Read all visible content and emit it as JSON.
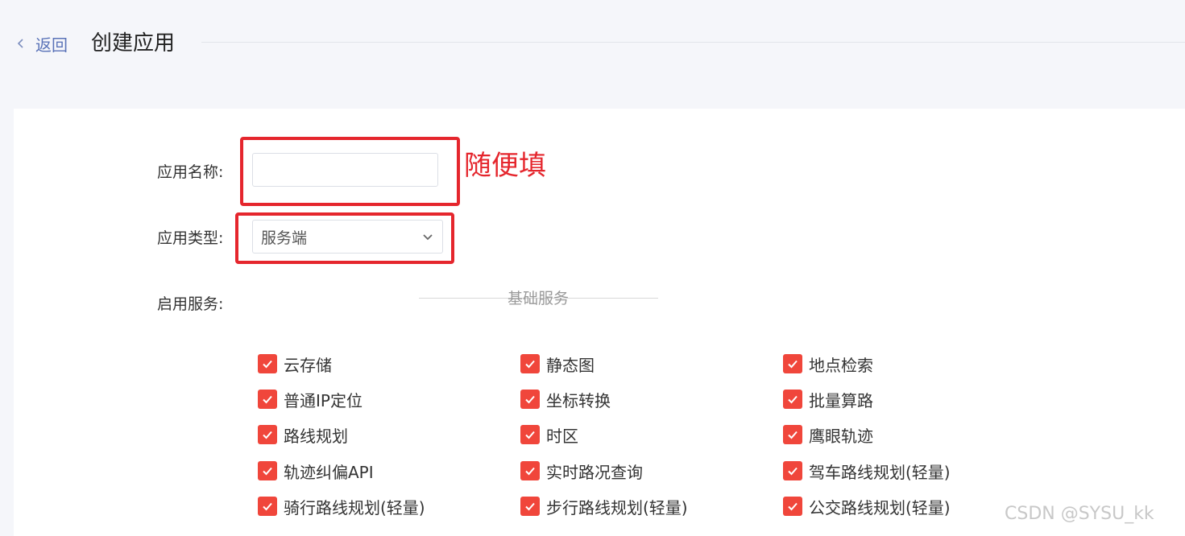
{
  "header": {
    "back_label": "返回",
    "title": "创建应用"
  },
  "form": {
    "name_label": "应用名称:",
    "name_value": "",
    "type_label": "应用类型:",
    "type_value": "服务端",
    "services_label": "启用服务:"
  },
  "annotation": {
    "text": "随便填",
    "color": "#e5262d"
  },
  "services": {
    "section_title": "基础服务",
    "items": [
      {
        "label": "云存储",
        "checked": true
      },
      {
        "label": "静态图",
        "checked": true
      },
      {
        "label": "地点检索",
        "checked": true
      },
      {
        "label": "普通IP定位",
        "checked": true
      },
      {
        "label": "坐标转换",
        "checked": true
      },
      {
        "label": "批量算路",
        "checked": true
      },
      {
        "label": "路线规划",
        "checked": true
      },
      {
        "label": "时区",
        "checked": true
      },
      {
        "label": "鹰眼轨迹",
        "checked": true
      },
      {
        "label": "轨迹纠偏API",
        "checked": true
      },
      {
        "label": "实时路况查询",
        "checked": true
      },
      {
        "label": "驾车路线规划(轻量)",
        "checked": true
      },
      {
        "label": "骑行路线规划(轻量)",
        "checked": true
      },
      {
        "label": "步行路线规划(轻量)",
        "checked": true
      },
      {
        "label": "公交路线规划(轻量)",
        "checked": true
      }
    ]
  },
  "colors": {
    "checkbox": "#f0463b",
    "link": "#5a73b8",
    "background": "#f5f6fa"
  },
  "watermark": "CSDN @SYSU_kk"
}
